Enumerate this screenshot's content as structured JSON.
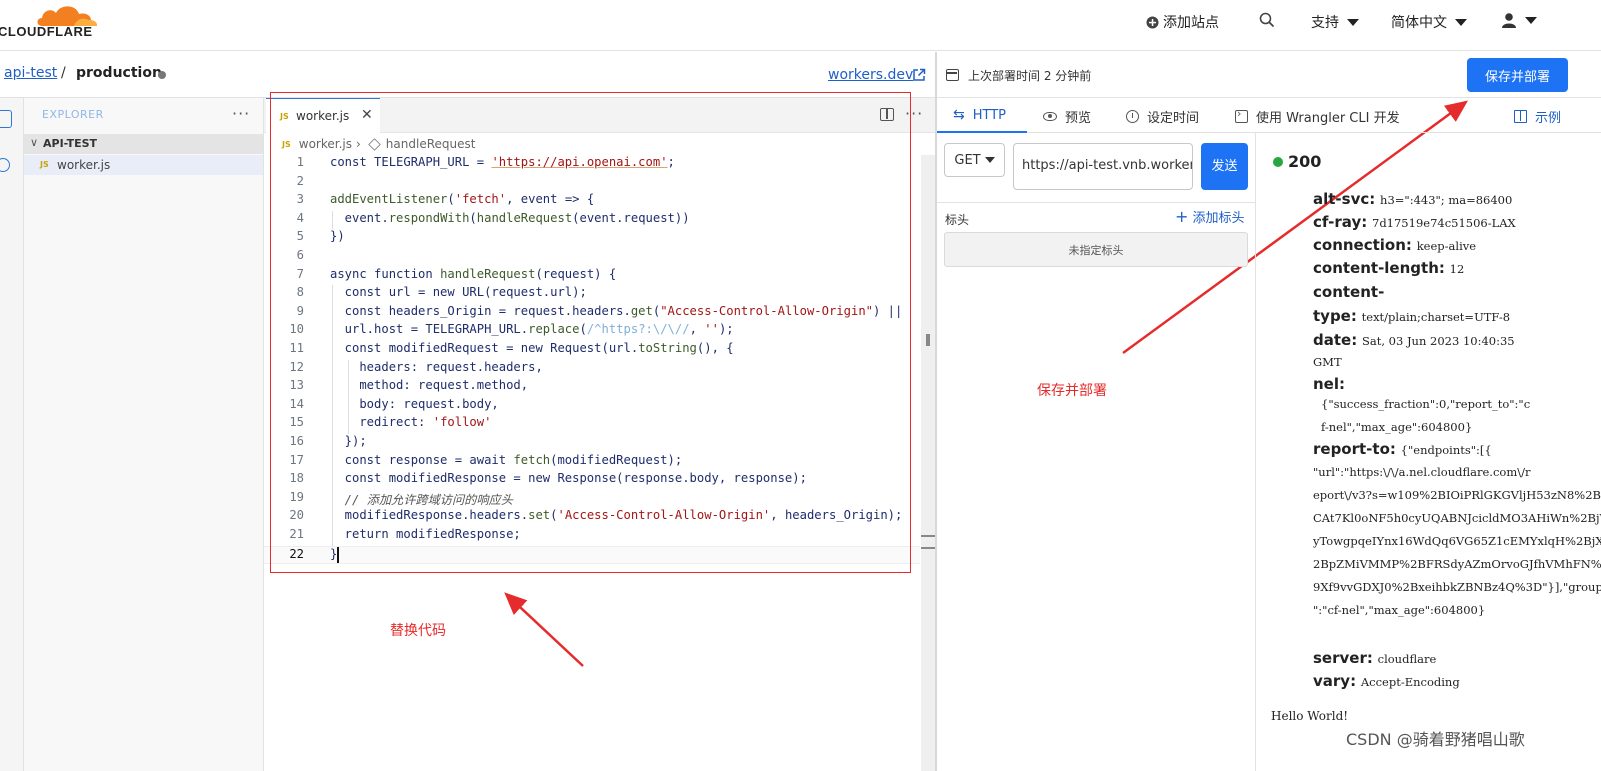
{
  "topnav": {
    "brand": "CLOUDFLARE",
    "add_site": "添加站点",
    "support": "支持",
    "language": "简体中文"
  },
  "breadcrumb": {
    "project": "api-test",
    "separator": "/",
    "environment": "production",
    "workers_link": "workers.dev"
  },
  "explorer": {
    "title": "EXPLORER",
    "folder": "API-TEST",
    "file_badge": "JS",
    "file": "worker.js"
  },
  "editor": {
    "tab_label": "worker.js",
    "tab_badge": "JS",
    "path_file": "worker.js",
    "path_symbol": "handleRequest",
    "current_line": 22,
    "lines": [
      "const TELEGRAPH_URL = 'https://api.openai.com';",
      "",
      "addEventListener('fetch', event => {",
      "  event.respondWith(handleRequest(event.request))",
      "})",
      "",
      "async function handleRequest(request) {",
      "  const url = new URL(request.url);",
      "  const headers_Origin = request.headers.get(\"Access-Control-Allow-Origin\") ||",
      "  url.host = TELEGRAPH_URL.replace(/^https?:\\/\\//, '');",
      "  const modifiedRequest = new Request(url.toString(), {",
      "    headers: request.headers,",
      "    method: request.method,",
      "    body: request.body,",
      "    redirect: 'follow'",
      "  });",
      "  const response = await fetch(modifiedRequest);",
      "  const modifiedResponse = new Response(response.body, response);",
      "  // 添加允许跨域访问的响应头",
      "  modifiedResponse.headers.set('Access-Control-Allow-Origin', headers_Origin);",
      "  return modifiedResponse;",
      "}"
    ]
  },
  "annotations": {
    "replace_code": "替换代码",
    "save_deploy": "保存并部署"
  },
  "right_panel": {
    "last_deploy": "上次部署时间 2 分钟前",
    "deploy_button": "保存并部署",
    "tabs": [
      "HTTP",
      "预览",
      "设定时间",
      "使用 Wrangler CLI 开发"
    ],
    "examples": "示例",
    "request": {
      "method": "GET",
      "url": "https://api-test.vnb.workers.dev",
      "send": "发送",
      "headers_label": "标头",
      "add_header": "添加标头",
      "no_headers": "未指定标头"
    },
    "response": {
      "status": "200",
      "headers": [
        {
          "k": "alt-svc:",
          "v": "h3=\":443\"; ma=86400"
        },
        {
          "k": "cf-ray:",
          "v": "7d17519e74c51506-LAX"
        },
        {
          "k": "connection:",
          "v": "keep-alive"
        },
        {
          "k": "content-length:",
          "v": "12"
        },
        {
          "k": "content-type:",
          "v": "text/plain;charset=UTF-8"
        },
        {
          "k": "date:",
          "v": "Sat, 03 Jun 2023 10:40:35 GMT"
        },
        {
          "k": "nel:",
          "v": "{\"success_fraction\":0,\"report_to\":\"cf-nel\",\"max_age\":604800}"
        },
        {
          "k": "report-to:",
          "v": "{\"endpoints\":[{\"url\":\"https:\\/\\/a.nel.cloudflare.com\\/report\\/v3?s=w109%2BIOiPRlGKGVljH53zN8%2BCAt7Kl0oNF5h0cyUQABNJcicldMO3AHiWn%2BjWwyTowgpqeIYnx16WdQq6VG65Z1cEMYxlqH%2BjXl%2BpZMiVMMP%2BFRSdyAZmOrvoGJfhVMhFN%2BMck9Xf9vvGDXJ0%2BxeihbkZBNBz4Q%3D\"}],\"group\":\"cf-nel\",\"max_age\":604800}"
        },
        {
          "k": "server:",
          "v": "cloudflare"
        },
        {
          "k": "vary:",
          "v": "Accept-Encoding"
        }
      ],
      "body": "Hello World!"
    }
  },
  "watermark": "CSDN @骑着野猪唱山歌",
  "colors": {
    "accent": "#1d73f4",
    "annotation": "#e52b2b",
    "brand_orange": "#f38020",
    "status_ok": "#27a744"
  }
}
